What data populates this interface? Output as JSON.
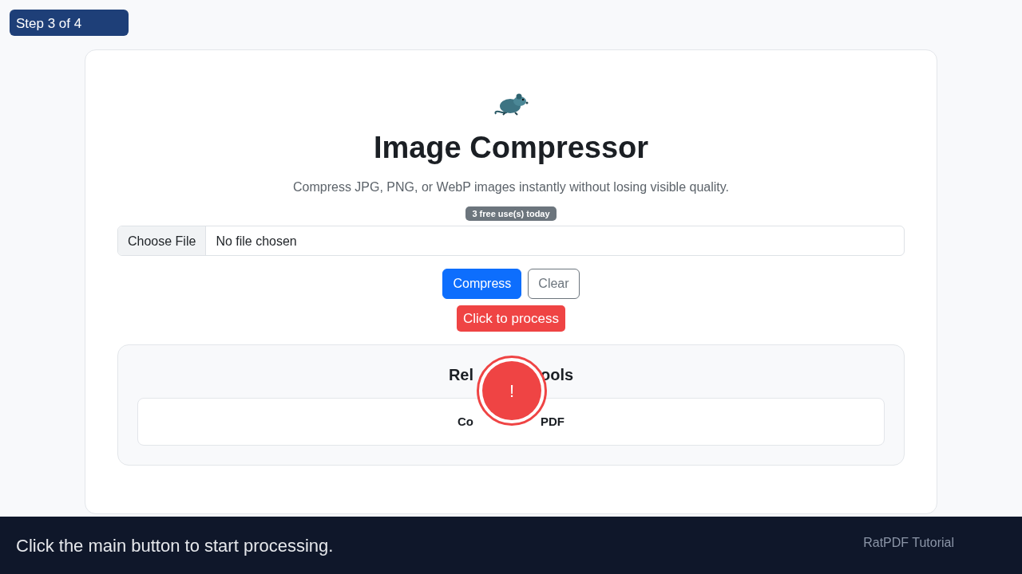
{
  "step_badge": "Step 3 of 4",
  "card": {
    "title": "Image Compressor",
    "subtitle": "Compress JPG, PNG, or WebP images instantly without losing visible quality.",
    "usage_badge": "3 free use(s) today",
    "file_input": {
      "button": "Choose File",
      "value": "No file chosen"
    },
    "buttons": [
      {
        "label": "Compress",
        "kind": "primary"
      },
      {
        "label": "Clear",
        "kind": "outline"
      }
    ],
    "related": {
      "title_parts": [
        "Rel",
        "ools"
      ],
      "items": [
        {
          "parts": [
            "Co",
            "PDF"
          ]
        }
      ]
    }
  },
  "tooltip": "Click to process",
  "marker": "!",
  "footer": {
    "instruction": "Click the main button to start processing.",
    "brand": "RatPDF Tutorial"
  }
}
